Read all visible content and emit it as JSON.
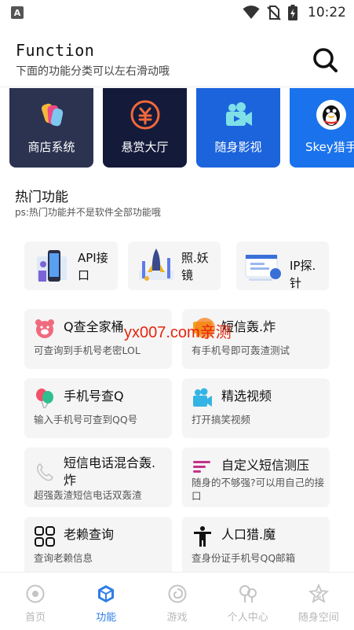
{
  "status_bar": {
    "time": "10:22",
    "icons": [
      "app-badge-icon",
      "wifi-icon",
      "no-sim-icon",
      "battery-charging-icon"
    ]
  },
  "header": {
    "title": "Function",
    "subtitle": "下面的功能分类可以左右滑动哦",
    "search_icon": "search-icon"
  },
  "categories": [
    {
      "label": "商店系统",
      "icon": "store-icon",
      "color": "#2b3350"
    },
    {
      "label": "悬赏大厅",
      "icon": "yuan-coin-icon",
      "color": "#141a3a"
    },
    {
      "label": "随身影视",
      "icon": "video-camera-icon",
      "color": "#1c64dc"
    },
    {
      "label": "Skey猎手",
      "icon": "penguin-icon",
      "color": "#1a73ec"
    }
  ],
  "hot": {
    "title": "热门功能",
    "note": "ps:热门功能并不是软件全部功能哦"
  },
  "tools": [
    {
      "label": "API接口",
      "icon": "api-illustration-icon"
    },
    {
      "label": "照.妖镜",
      "icon": "rocket-illustration-icon"
    },
    {
      "label": "IP探.针",
      "icon": "ip-illustration-icon"
    }
  ],
  "features": [
    {
      "title": "Q查全家桶",
      "desc": "可查询到手机号老密LOL",
      "icon": "pig-face-icon"
    },
    {
      "title": "短信轰.炸",
      "desc": "有手机号即可轰渣测试",
      "icon": "chat-bubble-icon"
    },
    {
      "title": "手机号查Q",
      "desc": "输入手机号可查到QQ号",
      "icon": "balloons-icon"
    },
    {
      "title": "精选视频",
      "desc": "打开搞笑视频",
      "icon": "video-camera-icon"
    },
    {
      "title": "短信电话混合轰.炸",
      "desc": "超强轰渣短信电话双轰渣",
      "icon": "phone-handset-icon"
    },
    {
      "title": "自定义短信测压",
      "desc": "随身的不够强?可以用自己的接口",
      "icon": "lines-icon"
    },
    {
      "title": "老赖查询",
      "desc": "查询老赖信息",
      "icon": "grid-apps-icon"
    },
    {
      "title": "人口猎.魔",
      "desc": "查身份证手机号QQ邮箱",
      "icon": "person-standing-icon"
    }
  ],
  "watermark": {
    "text": "yx007.com亲测"
  },
  "bottom_nav": [
    {
      "label": "首页",
      "icon": "home-circle-icon",
      "active": false
    },
    {
      "label": "功能",
      "icon": "cube-icon",
      "active": true
    },
    {
      "label": "游戏",
      "icon": "spiral-icon",
      "active": false
    },
    {
      "label": "个人中心",
      "icon": "person-bubbles-icon",
      "active": false
    },
    {
      "label": "随身空间",
      "icon": "z-star-icon",
      "active": false
    }
  ],
  "colors": {
    "accent": "#2f7ee6",
    "inactive": "#b8b8b8",
    "card_bg": "#f5f5f5"
  }
}
